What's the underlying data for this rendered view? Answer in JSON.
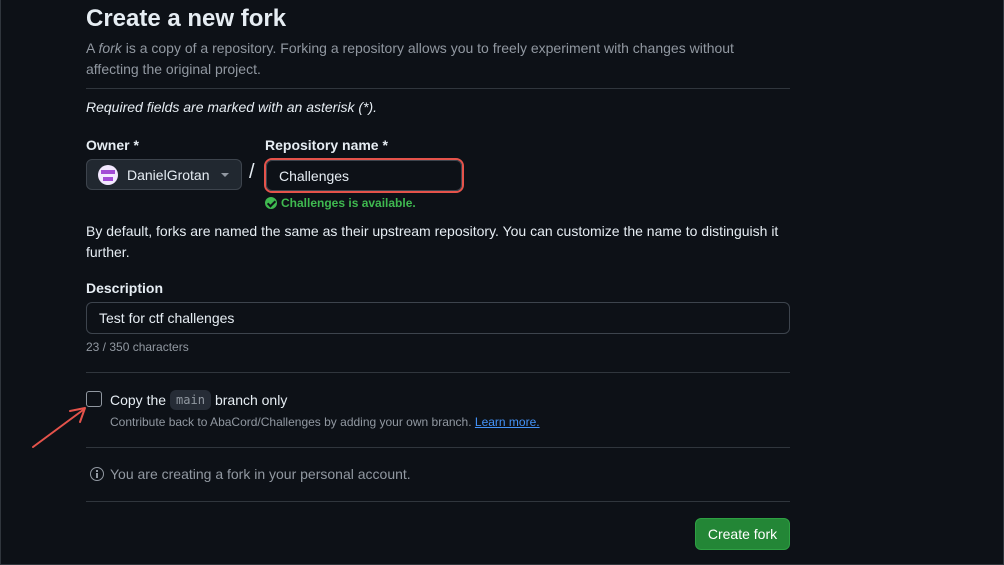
{
  "page": {
    "title": "Create a new fork",
    "subtitle_prefix": "A ",
    "subtitle_em": "fork",
    "subtitle_rest": " is a copy of a repository. Forking a repository allows you to freely experiment with changes without affecting the original project.",
    "required_note": "Required fields are marked with an asterisk (*)."
  },
  "owner": {
    "label": "Owner *",
    "value": "DanielGrotan",
    "icon": "avatar"
  },
  "separator": "/",
  "repository": {
    "label": "Repository name *",
    "value": "Challenges",
    "availability": "Challenges is available."
  },
  "naming_note": "By default, forks are named the same as their upstream repository. You can customize the name to distinguish it further.",
  "description": {
    "label": "Description",
    "value": "Test for ctf challenges",
    "counter": "23 / 350 characters"
  },
  "copy_branch": {
    "checked": false,
    "label_prefix": "Copy the",
    "branch": "main",
    "label_suffix": "branch only",
    "help_text": "Contribute back to AbaCord/Challenges by adding your own branch.",
    "learn_more": "Learn more."
  },
  "info": {
    "icon": "info-icon",
    "text": "You are creating a fork in your personal account."
  },
  "actions": {
    "create_label": "Create fork"
  },
  "colors": {
    "background": "#0d1117",
    "primary_button": "#238636",
    "success": "#3fb950",
    "link": "#4493f8",
    "annotation": "#e5534b"
  }
}
